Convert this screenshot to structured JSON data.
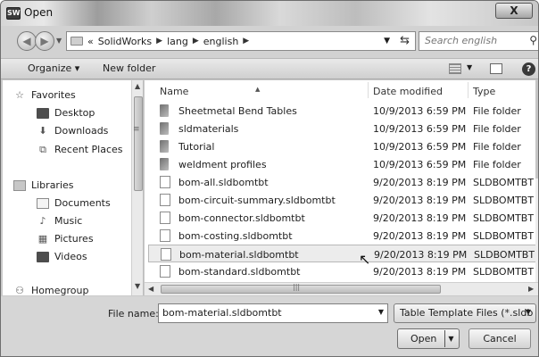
{
  "window": {
    "title": "Open",
    "close_label": "X",
    "app_icon_text": "SW"
  },
  "address": {
    "chevrons": "«",
    "crumbs": [
      "SolidWorks",
      "lang",
      "english"
    ],
    "search_placeholder": "Search english"
  },
  "toolbar": {
    "organize_label": "Organize ▾",
    "new_folder_label": "New folder",
    "help_label": "?"
  },
  "nav_pane": {
    "favorites": "Favorites",
    "desktop": "Desktop",
    "downloads": "Downloads",
    "recent_places": "Recent Places",
    "libraries": "Libraries",
    "documents": "Documents",
    "music": "Music",
    "pictures": "Pictures",
    "videos": "Videos",
    "homegroup": "Homegroup"
  },
  "columns": {
    "name": "Name",
    "date_modified": "Date modified",
    "type": "Type"
  },
  "files": [
    {
      "name": "Sheetmetal Bend Tables",
      "date": "10/9/2013 6:59 PM",
      "type": "File folder"
    },
    {
      "name": "sldmaterials",
      "date": "10/9/2013 6:59 PM",
      "type": "File folder"
    },
    {
      "name": "Tutorial",
      "date": "10/9/2013 6:59 PM",
      "type": "File folder"
    },
    {
      "name": "weldment profiles",
      "date": "10/9/2013 6:59 PM",
      "type": "File folder"
    },
    {
      "name": "bom-all.sldbomtbt",
      "date": "9/20/2013 8:19 PM",
      "type": "SLDBOMTBT F"
    },
    {
      "name": "bom-circuit-summary.sldbomtbt",
      "date": "9/20/2013 8:19 PM",
      "type": "SLDBOMTBT F"
    },
    {
      "name": "bom-connector.sldbomtbt",
      "date": "9/20/2013 8:19 PM",
      "type": "SLDBOMTBT F"
    },
    {
      "name": "bom-costing.sldbomtbt",
      "date": "9/20/2013 8:19 PM",
      "type": "SLDBOMTBT F"
    },
    {
      "name": "bom-material.sldbomtbt",
      "date": "9/20/2013 8:19 PM",
      "type": "SLDBOMTBT F"
    },
    {
      "name": "bom-standard.sldbomtbt",
      "date": "9/20/2013 8:19 PM",
      "type": "SLDBOMTBT F"
    }
  ],
  "bottom": {
    "file_name_label": "File name:",
    "file_name_value": "bom-material.sldbomtbt",
    "filter_label": "Table Template Files (*.sldb",
    "open_label": "Open",
    "cancel_label": "Cancel"
  }
}
